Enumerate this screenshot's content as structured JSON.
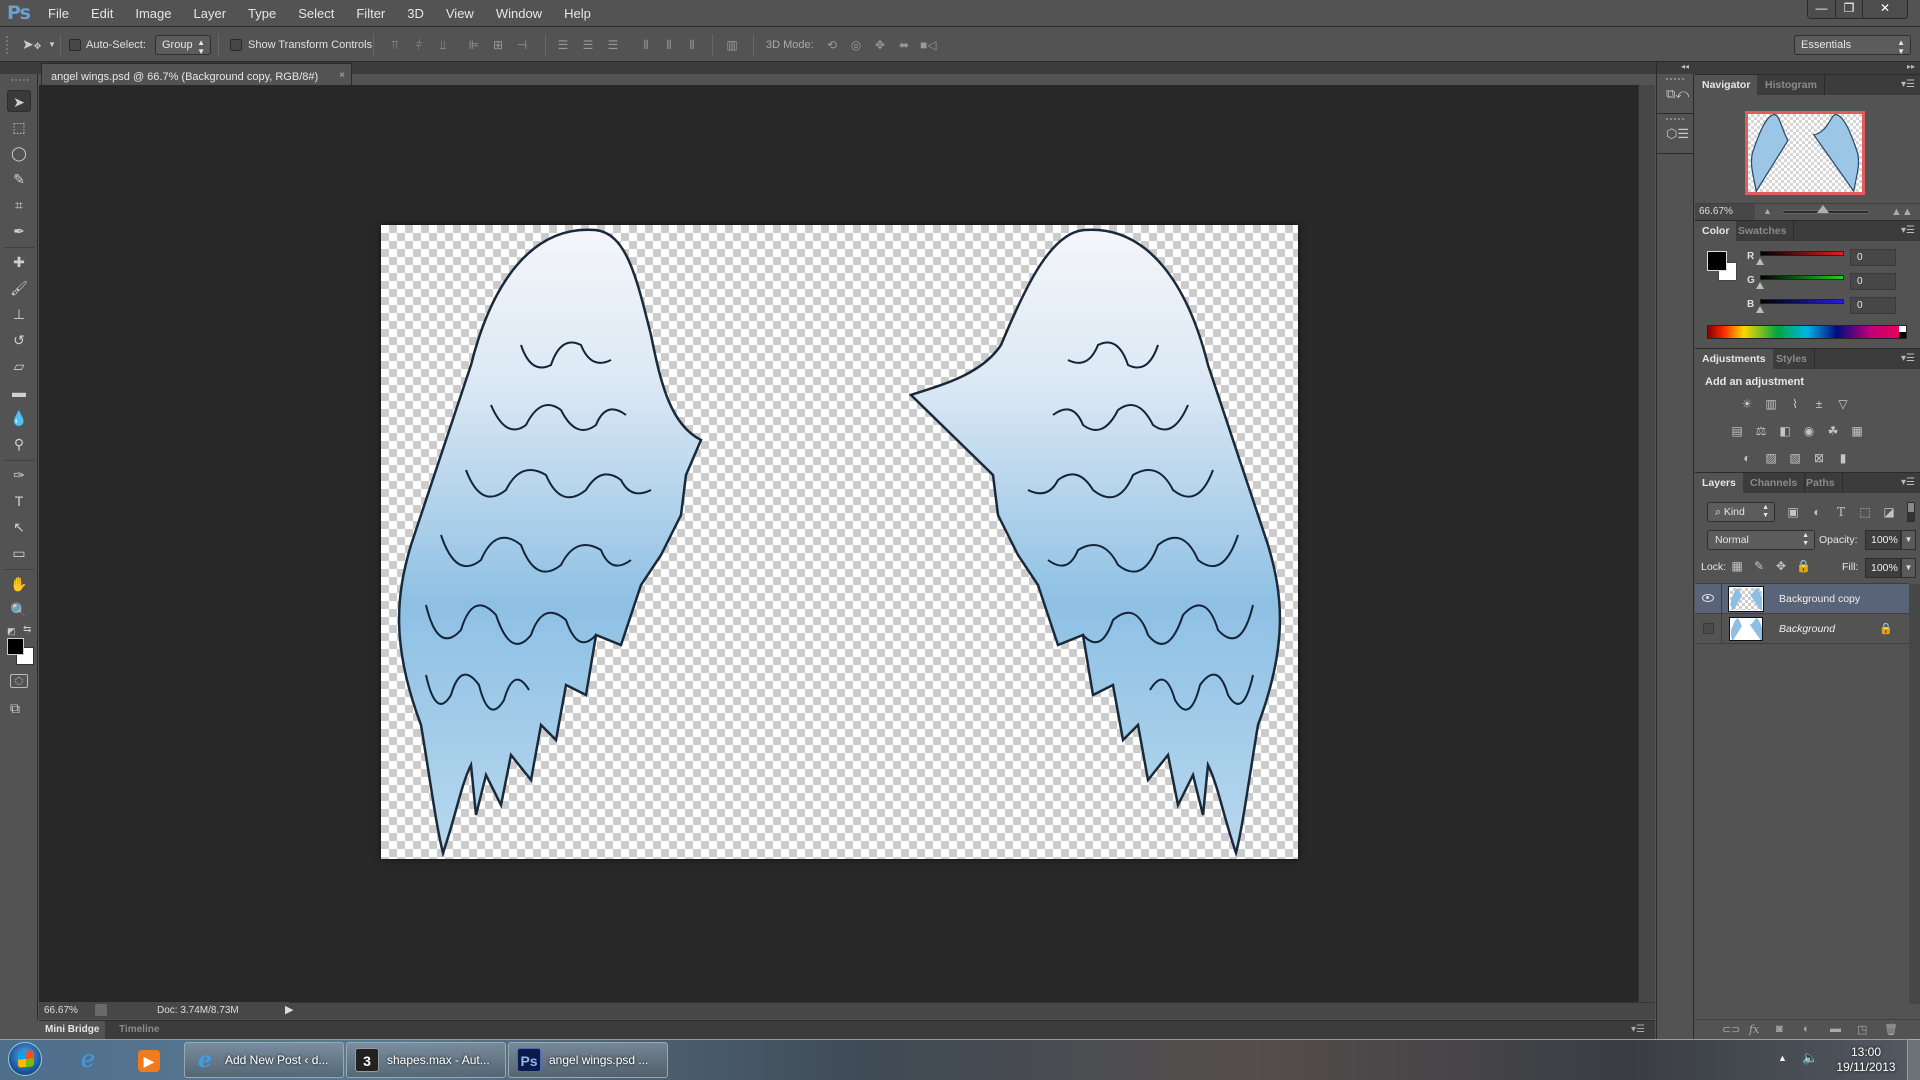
{
  "app": {
    "logo": "Ps",
    "menu": [
      "File",
      "Edit",
      "Image",
      "Layer",
      "Type",
      "Select",
      "Filter",
      "3D",
      "View",
      "Window",
      "Help"
    ],
    "window_buttons": {
      "minimize": "—",
      "restore": "❐",
      "close": "✕"
    }
  },
  "options_bar": {
    "auto_select_label": "Auto-Select:",
    "auto_select_checked": false,
    "auto_select_mode": "Group",
    "show_transform_label": "Show Transform Controls",
    "show_transform_checked": false,
    "mode_3d_label": "3D Mode:",
    "workspace": "Essentials"
  },
  "document": {
    "tab_title": "angel wings.psd @ 66.7% (Background copy, RGB/8#)",
    "close": "×"
  },
  "status": {
    "zoom": "66.67%",
    "doc_size": "Doc: 3.74M/8.73M",
    "arrow": "▶"
  },
  "bottom_tabs": [
    "Mini Bridge",
    "Timeline"
  ],
  "tools": [
    {
      "name": "move-tool",
      "glyph": "➤"
    },
    {
      "name": "marquee-tool",
      "glyph": "⬚"
    },
    {
      "name": "lasso-tool",
      "glyph": "◯"
    },
    {
      "name": "quick-selection-tool",
      "glyph": "✎"
    },
    {
      "name": "crop-tool",
      "glyph": "⌗"
    },
    {
      "name": "eyedropper-tool",
      "glyph": "✒"
    },
    {
      "name": "healing-brush-tool",
      "glyph": "✚"
    },
    {
      "name": "brush-tool",
      "glyph": "🖌"
    },
    {
      "name": "clone-stamp-tool",
      "glyph": "⊥"
    },
    {
      "name": "history-brush-tool",
      "glyph": "↺"
    },
    {
      "name": "eraser-tool",
      "glyph": "▱"
    },
    {
      "name": "gradient-tool",
      "glyph": "▬"
    },
    {
      "name": "blur-tool",
      "glyph": "💧"
    },
    {
      "name": "dodge-tool",
      "glyph": "⚲"
    },
    {
      "name": "pen-tool",
      "glyph": "✑"
    },
    {
      "name": "type-tool",
      "glyph": "T"
    },
    {
      "name": "path-selection-tool",
      "glyph": "↖"
    },
    {
      "name": "rectangle-tool",
      "glyph": "▭"
    },
    {
      "name": "hand-tool",
      "glyph": "✋"
    },
    {
      "name": "zoom-tool",
      "glyph": "🔍"
    }
  ],
  "navigator": {
    "tabs": [
      "Navigator",
      "Histogram"
    ],
    "zoom": "66.67%",
    "zoom_slider_fraction": 0.45
  },
  "color": {
    "tabs": [
      "Color",
      "Swatches"
    ],
    "foreground": "#000000",
    "background": "#ffffff",
    "channels": [
      {
        "label": "R",
        "value": "0",
        "color": "#e02020"
      },
      {
        "label": "G",
        "value": "0",
        "color": "#20d020"
      },
      {
        "label": "B",
        "value": "0",
        "color": "#2020e0"
      }
    ]
  },
  "adjustments": {
    "tabs": [
      "Adjustments",
      "Styles"
    ],
    "title": "Add an adjustment",
    "rows": [
      [
        "☀",
        "▥",
        "⌇",
        "±",
        "▽"
      ],
      [
        "▤",
        "⚖",
        "◧",
        "◉",
        "☘",
        "▦"
      ],
      [
        "◐",
        "▨",
        "▧",
        "⊠",
        "▮"
      ]
    ]
  },
  "layers": {
    "tabs": [
      "Layers",
      "Channels",
      "Paths"
    ],
    "filter_kind": "Kind",
    "blend_mode": "Normal",
    "opacity_label": "Opacity:",
    "opacity": "100%",
    "lock_label": "Lock:",
    "fill_label": "Fill:",
    "fill": "100%",
    "items": [
      {
        "name": "Background copy",
        "visible": true,
        "selected": true,
        "locked": false
      },
      {
        "name": "Background",
        "visible": false,
        "selected": false,
        "locked": true
      }
    ]
  },
  "taskbar": {
    "pinned": [
      "internet-explorer",
      "media-player"
    ],
    "windows": [
      {
        "label": "Add New Post ‹ d...",
        "icon": "e"
      },
      {
        "label": "shapes.max - Aut...",
        "icon": "3"
      },
      {
        "label": "angel wings.psd ...",
        "icon": "Ps"
      }
    ],
    "time": "13:00",
    "date": "19/11/2013"
  }
}
